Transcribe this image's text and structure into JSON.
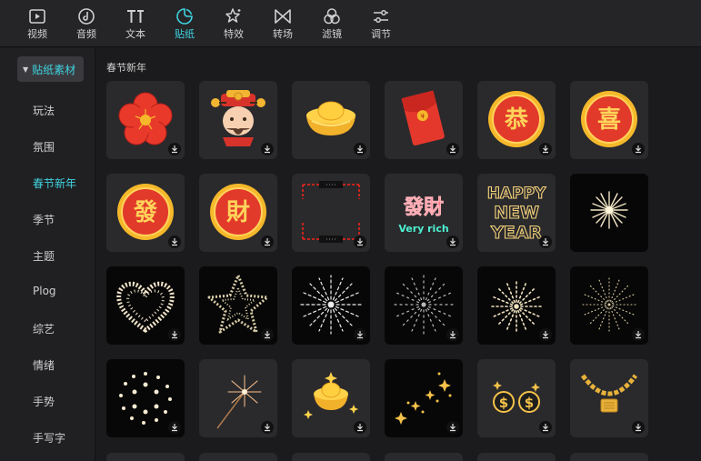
{
  "toolbar": {
    "items": [
      {
        "label": "视频",
        "icon": "video-icon"
      },
      {
        "label": "音频",
        "icon": "audio-icon"
      },
      {
        "label": "文本",
        "icon": "text-icon"
      },
      {
        "label": "贴纸",
        "icon": "sticker-icon",
        "active": true
      },
      {
        "label": "特效",
        "icon": "effects-icon"
      },
      {
        "label": "转场",
        "icon": "transition-icon"
      },
      {
        "label": "滤镜",
        "icon": "filter-icon"
      },
      {
        "label": "调节",
        "icon": "adjust-icon"
      }
    ]
  },
  "sidebar": {
    "header": "贴纸素材",
    "items": [
      "玩法",
      "氛围",
      "春节新年",
      "季节",
      "主题",
      "Plog",
      "综艺",
      "情绪",
      "手势",
      "手写字"
    ],
    "active_index": 2
  },
  "content": {
    "section_title": "春节新年",
    "sticker_text": {
      "gong": "恭",
      "xi": "喜",
      "fa": "發",
      "cai": "財",
      "facai": "發財",
      "very_rich": "Very rich",
      "happy": "HAPPY",
      "new": "NEW",
      "year": "YEAR"
    }
  },
  "colors": {
    "accent": "#3fd3e0",
    "background": "#1b1b1d",
    "tile": "#2a2a2d",
    "festive_red": "#e23a2a",
    "gold": "#f5b82a"
  }
}
